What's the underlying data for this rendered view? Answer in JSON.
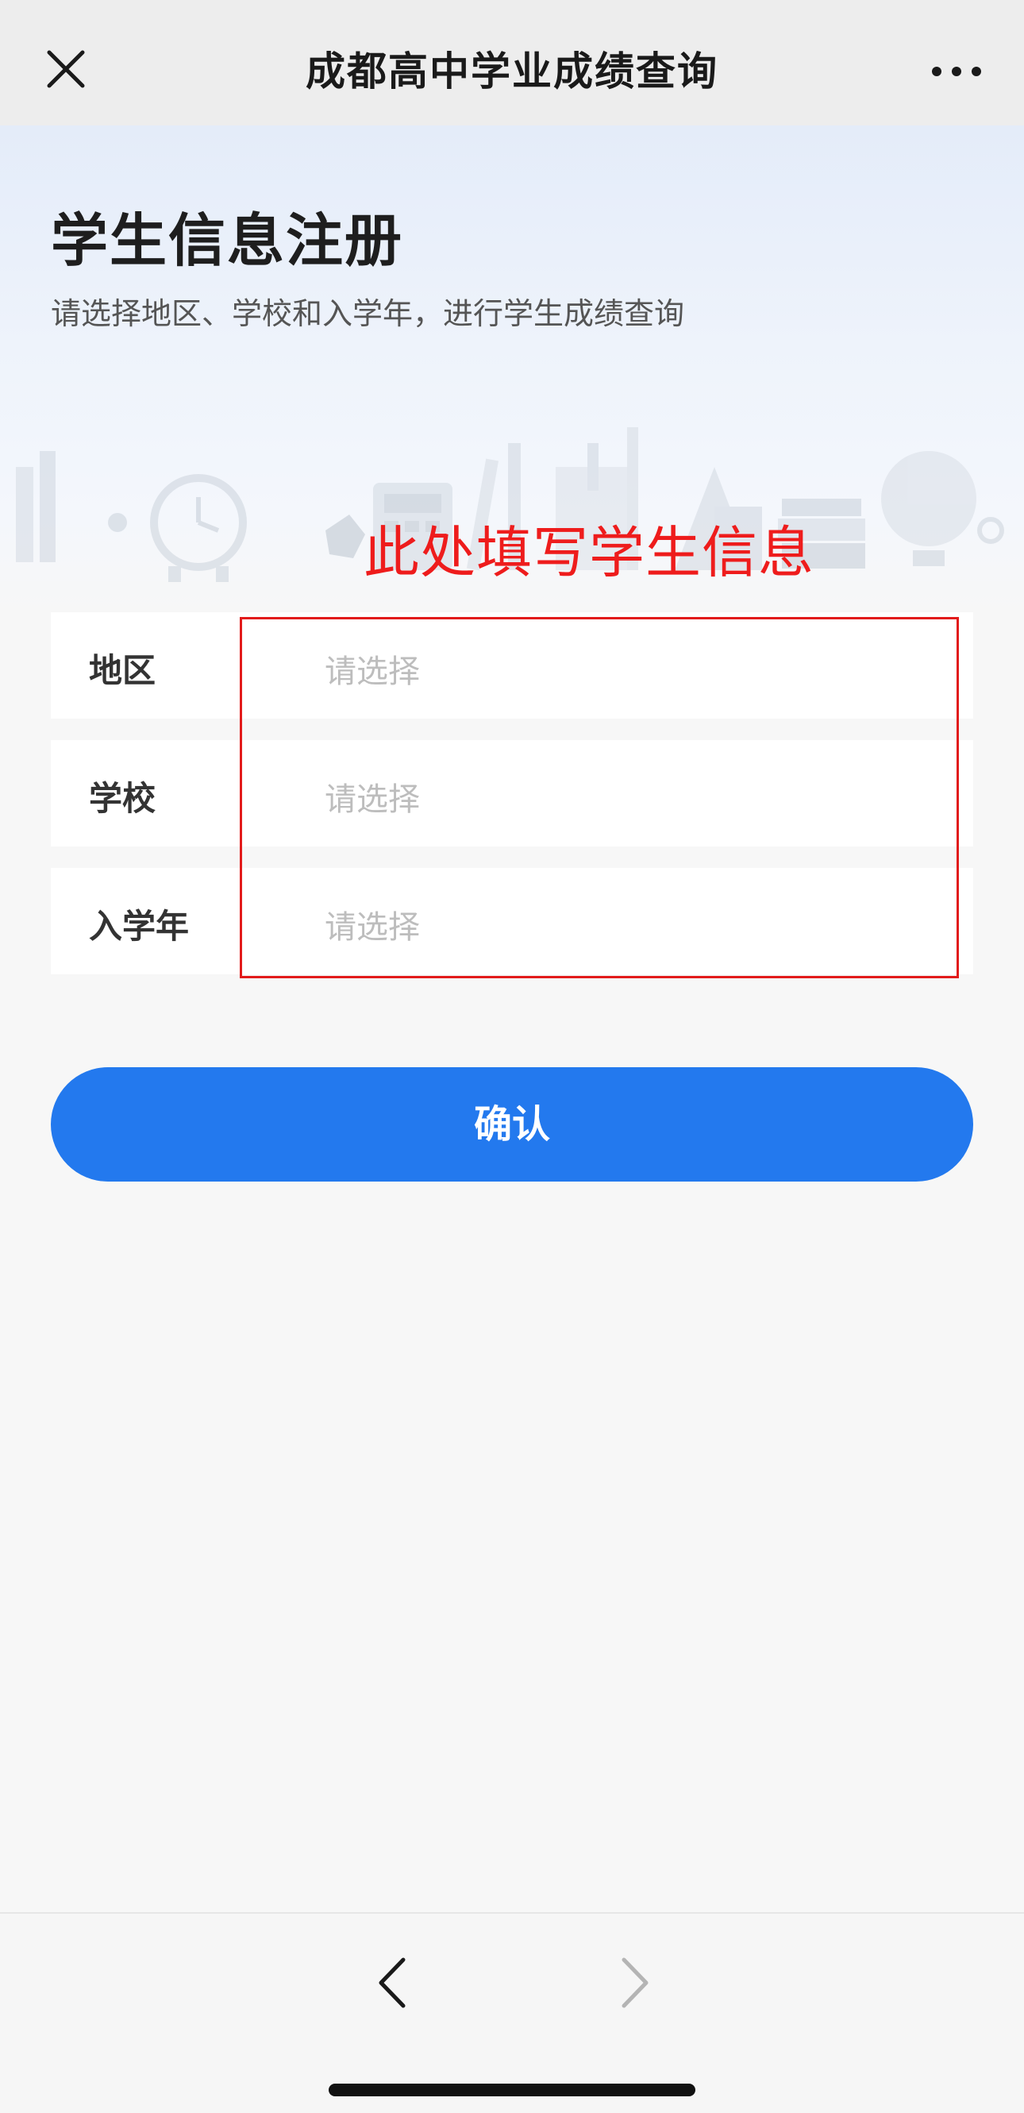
{
  "header": {
    "title": "成都高中学业成绩查询",
    "close_icon": "close-icon",
    "more_icon": "more-icon"
  },
  "hero": {
    "title": "学生信息注册",
    "subtitle": "请选择地区、学校和入学年，进行学生成绩查询"
  },
  "annotation": {
    "text": "此处填写学生信息",
    "color": "#ee1c1c"
  },
  "form": {
    "fields": [
      {
        "label": "地区",
        "placeholder": "请选择"
      },
      {
        "label": "学校",
        "placeholder": "请选择"
      },
      {
        "label": "入学年",
        "placeholder": "请选择"
      }
    ],
    "confirm_label": "确认"
  },
  "colors": {
    "accent": "#2379ee",
    "annotation_red": "#e21b1b"
  },
  "bottom_nav": {
    "back_icon": "chevron-left-icon",
    "forward_icon": "chevron-right-icon"
  }
}
